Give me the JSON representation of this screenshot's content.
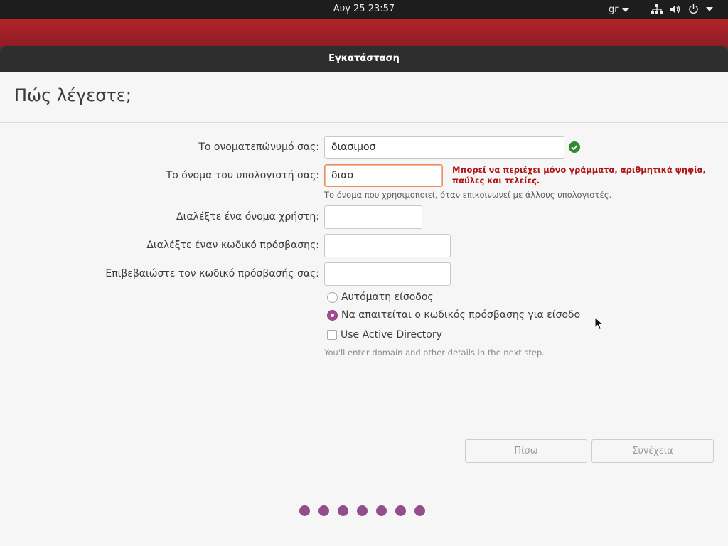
{
  "topbar": {
    "datetime": "Αυγ 25  23:57",
    "keyboard_layout": "gr",
    "icons": [
      "network-icon",
      "volume-icon",
      "power-icon",
      "chevron-down-icon"
    ]
  },
  "window": {
    "title": "Εγκατάσταση",
    "heading": "Πώς λέγεστε;"
  },
  "form": {
    "name": {
      "label": "Το ονοματεπώνυμό σας:",
      "value": "διασιμοσ",
      "status": "valid"
    },
    "computer": {
      "label": "Το όνομα του υπολογιστή σας:",
      "value": "διασ",
      "error": "Μπορεί να περιέχει μόνο γράμματα, αριθμητικά ψηφία, παύλες και τελείες.",
      "hint": "Το όνομα που χρησιμοποιεί, όταν επικοινωνεί με άλλους υπολογιστές."
    },
    "username": {
      "label": "Διαλέξτε ένα όνομα χρήστη:",
      "value": ""
    },
    "password": {
      "label": "Διαλέξτε έναν κωδικό πρόσβασης:",
      "value": ""
    },
    "confirm": {
      "label": "Επιβεβαιώστε τον κωδικό πρόσβασής σας:",
      "value": ""
    },
    "login": {
      "auto_label": "Αυτόματη είσοδος",
      "require_label": "Να απαιτείται ο κωδικός πρόσβασης για είσοδο",
      "selected": "require"
    },
    "active_directory": {
      "label": "Use Active Directory",
      "checked": false,
      "hint": "You'll enter domain and other details in the next step."
    }
  },
  "buttons": {
    "back": "Πίσω",
    "continue": "Συνέχεια"
  },
  "progress": {
    "steps": 7
  },
  "colors": {
    "accent": "#924d8b",
    "error": "#b01515",
    "ok": "#2e8b2e",
    "header": "#2e2e2e"
  }
}
